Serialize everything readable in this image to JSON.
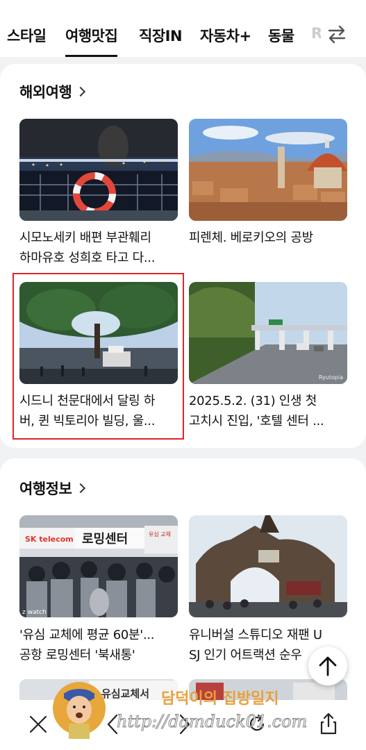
{
  "tabs": [
    "스타일",
    "여행맛집",
    "직장IN",
    "자동차+",
    "동물"
  ],
  "active_tab": "여행맛집",
  "sections": [
    {
      "title": "해외여행",
      "items": [
        {
          "line1": "시모노세키 배편 부관훼리",
          "line2": "하마유호 성희호 타고 다..."
        },
        {
          "line1": "피렌체. 베로키오의 공방",
          "line2": ""
        },
        {
          "line1": "시드니 천문대에서 달링 하",
          "line2": "버, 퀸 빅토리아 빌딩, 울..."
        },
        {
          "line1": "2025.5.2. (31) 인생 첫",
          "line2": "고치시 진입, '호텔 센터 ..."
        }
      ]
    },
    {
      "title": "여행정보",
      "items": [
        {
          "line1": "'유심 교체에 평균 60분'...",
          "line2": "공항 로밍센터 '북새통'"
        },
        {
          "line1": "유니버설 스튜디오 재팬 U",
          "line2": "SJ 인기 어트랙션 순우"
        }
      ]
    }
  ],
  "image_text": {
    "sk": "SK telecom",
    "roaming": "로밍센터",
    "usim": "유심 교체",
    "usim2": "유심교체서",
    "watch": "z watch",
    "ryutopia": "Ryutopia"
  },
  "watermark": {
    "title": "담덕이의 집방일지",
    "url": "http://damduck01.com"
  },
  "colors": {
    "highlight": "#e02424",
    "accent": "#111111"
  }
}
